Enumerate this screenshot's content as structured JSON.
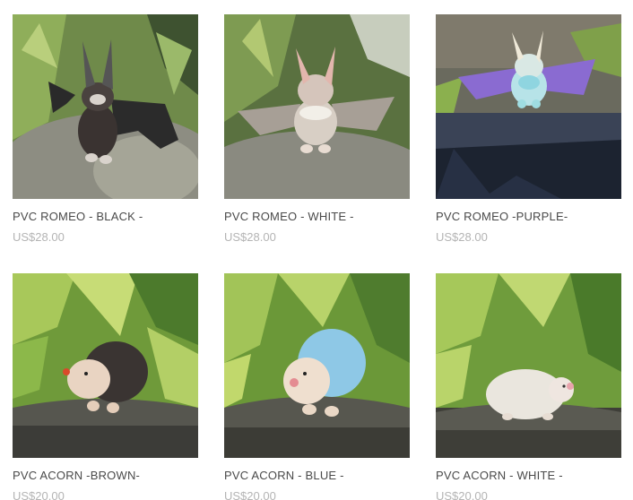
{
  "products": [
    {
      "title": "PVC ROMEO - BLACK -",
      "price": "US$28.00",
      "image": "black-bat-figure"
    },
    {
      "title": "PVC ROMEO - WHITE -",
      "price": "US$28.00",
      "image": "white-bat-figure"
    },
    {
      "title": "PVC ROMEO -PURPLE-",
      "price": "US$28.00",
      "image": "purple-bat-figure"
    },
    {
      "title": "PVC ACORN -BROWN-",
      "price": "US$20.00",
      "image": "brown-hedgehog-figure"
    },
    {
      "title": "PVC ACORN - BLUE -",
      "price": "US$20.00",
      "image": "blue-hedgehog-figure"
    },
    {
      "title": "PVC ACORN - WHITE -",
      "price": "US$20.00",
      "image": "white-hedgehog-figure"
    }
  ]
}
